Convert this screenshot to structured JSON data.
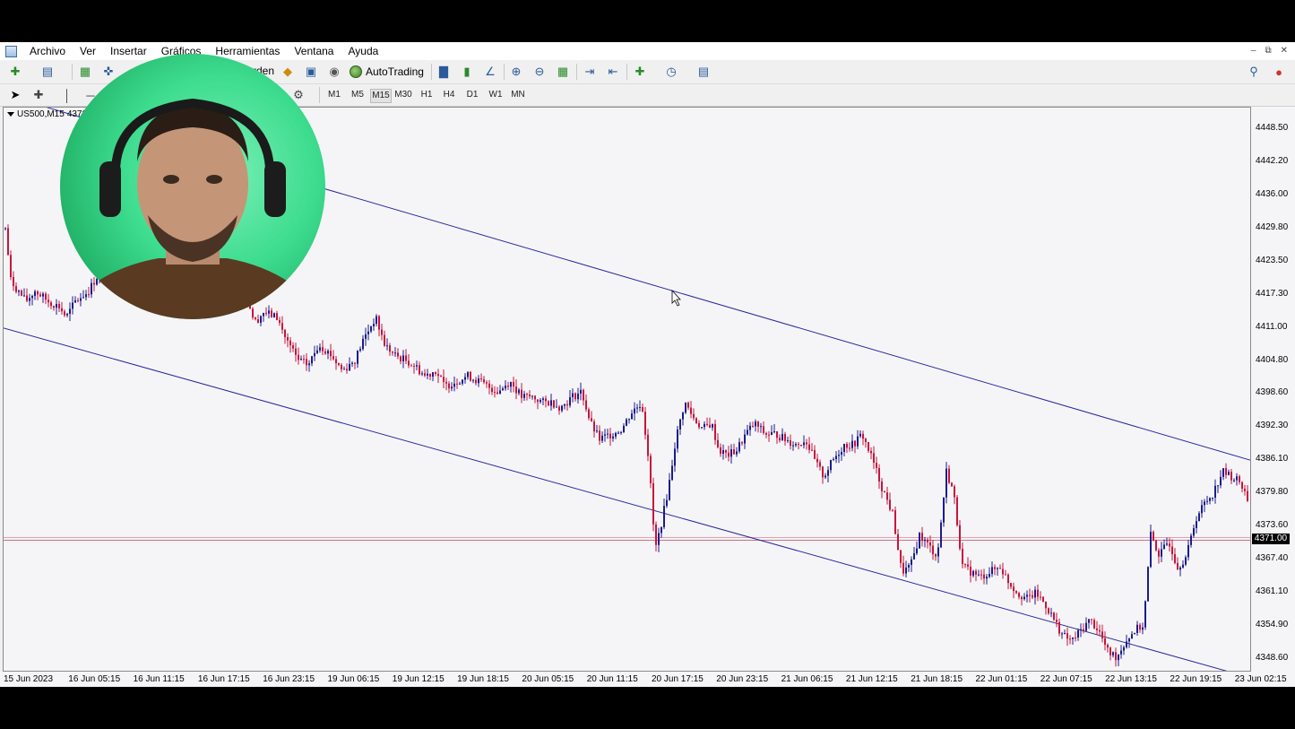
{
  "menu": [
    "Archivo",
    "Ver",
    "Insertar",
    "Gráficos",
    "Herramientas",
    "Ventana",
    "Ayuda"
  ],
  "toolbar": {
    "order_label_partial": "rden",
    "autotrading_label": "AutoTrading"
  },
  "timeframes": [
    "M1",
    "M5",
    "M15",
    "M30",
    "H1",
    "H4",
    "D1",
    "W1",
    "MN"
  ],
  "active_timeframe": "M15",
  "symbol": "US500,M15",
  "symbol_price_partial": "4372",
  "price_axis": [
    "4448.50",
    "4442.20",
    "4436.00",
    "4429.80",
    "4423.50",
    "4417.30",
    "4411.00",
    "4404.80",
    "4398.60",
    "4392.30",
    "4386.10",
    "4379.80",
    "4373.60",
    "4367.40",
    "4361.10",
    "4354.90",
    "4348.60"
  ],
  "current_price": "4371.00",
  "time_axis": [
    "15 Jun 2023",
    "16 Jun 05:15",
    "16 Jun 11:15",
    "16 Jun 17:15",
    "16 Jun 23:15",
    "19 Jun 06:15",
    "19 Jun 12:15",
    "19 Jun 18:15",
    "20 Jun 05:15",
    "20 Jun 11:15",
    "20 Jun 17:15",
    "20 Jun 23:15",
    "21 Jun 06:15",
    "21 Jun 12:15",
    "21 Jun 18:15",
    "22 Jun 01:15",
    "22 Jun 07:15",
    "22 Jun 13:15",
    "22 Jun 19:15",
    "23 Jun 02:15"
  ],
  "colors": {
    "bull_candle": "#1c1c8c",
    "bear_candle": "#c8143c",
    "channel_line": "#2a2aa0",
    "price_line": "#d07080",
    "background": "#f5f5f7"
  },
  "chart_data": {
    "type": "candlestick",
    "symbol": "US500",
    "timeframe": "M15",
    "ylim": [
      4345,
      4455
    ],
    "close_path": [
      [
        0,
        4433
      ],
      [
        8,
        4420
      ],
      [
        16,
        4418
      ],
      [
        25,
        4416
      ],
      [
        35,
        4418
      ],
      [
        50,
        4416
      ],
      [
        62,
        4415
      ],
      [
        70,
        4413
      ],
      [
        80,
        4416
      ],
      [
        95,
        4418
      ],
      [
        105,
        4421
      ],
      [
        118,
        4423
      ],
      [
        270,
        4418
      ],
      [
        280,
        4412
      ],
      [
        290,
        4414
      ],
      [
        305,
        4413
      ],
      [
        315,
        4409
      ],
      [
        328,
        4405
      ],
      [
        340,
        4404
      ],
      [
        352,
        4408
      ],
      [
        365,
        4406
      ],
      [
        378,
        4403
      ],
      [
        392,
        4405
      ],
      [
        402,
        4409
      ],
      [
        415,
        4413
      ],
      [
        425,
        4408
      ],
      [
        435,
        4406
      ],
      [
        448,
        4405
      ],
      [
        458,
        4404
      ],
      [
        470,
        4402
      ],
      [
        482,
        4403
      ],
      [
        492,
        4400
      ],
      [
        505,
        4401
      ],
      [
        518,
        4402
      ],
      [
        530,
        4401
      ],
      [
        540,
        4400
      ],
      [
        552,
        4399
      ],
      [
        565,
        4401
      ],
      [
        578,
        4398
      ],
      [
        590,
        4398
      ],
      [
        602,
        4397
      ],
      [
        612,
        4397
      ],
      [
        622,
        4396
      ],
      [
        634,
        4398
      ],
      [
        645,
        4399
      ],
      [
        655,
        4393
      ],
      [
        665,
        4390
      ],
      [
        678,
        4391
      ],
      [
        690,
        4392
      ],
      [
        700,
        4395
      ],
      [
        712,
        4397
      ],
      [
        720,
        4386
      ],
      [
        727,
        4369
      ],
      [
        735,
        4375
      ],
      [
        742,
        4381
      ],
      [
        750,
        4390
      ],
      [
        760,
        4397
      ],
      [
        770,
        4394
      ],
      [
        780,
        4392
      ],
      [
        790,
        4393
      ],
      [
        798,
        4388
      ],
      [
        808,
        4387
      ],
      [
        818,
        4388
      ],
      [
        828,
        4391
      ],
      [
        838,
        4393
      ],
      [
        850,
        4391
      ],
      [
        862,
        4391
      ],
      [
        872,
        4390
      ],
      [
        885,
        4389
      ],
      [
        895,
        4390
      ],
      [
        905,
        4386
      ],
      [
        915,
        4383
      ],
      [
        925,
        4386
      ],
      [
        938,
        4389
      ],
      [
        948,
        4389
      ],
      [
        958,
        4391
      ],
      [
        970,
        4386
      ],
      [
        980,
        4381
      ],
      [
        992,
        4376
      ],
      [
        1002,
        4365
      ],
      [
        1012,
        4366
      ],
      [
        1022,
        4372
      ],
      [
        1032,
        4370
      ],
      [
        1042,
        4368
      ],
      [
        1052,
        4384
      ],
      [
        1060,
        4380
      ],
      [
        1070,
        4366
      ],
      [
        1080,
        4365
      ],
      [
        1090,
        4364
      ],
      [
        1100,
        4365
      ],
      [
        1112,
        4366
      ],
      [
        1122,
        4363
      ],
      [
        1132,
        4361
      ],
      [
        1142,
        4360
      ],
      [
        1152,
        4361
      ],
      [
        1162,
        4359
      ],
      [
        1172,
        4356
      ],
      [
        1182,
        4353
      ],
      [
        1192,
        4352
      ],
      [
        1202,
        4354
      ],
      [
        1212,
        4356
      ],
      [
        1222,
        4354
      ],
      [
        1232,
        4350
      ],
      [
        1242,
        4349
      ],
      [
        1252,
        4352
      ],
      [
        1262,
        4354
      ],
      [
        1272,
        4355
      ],
      [
        1280,
        4372
      ],
      [
        1290,
        4368
      ],
      [
        1300,
        4371
      ],
      [
        1310,
        4366
      ],
      [
        1320,
        4368
      ],
      [
        1330,
        4375
      ],
      [
        1340,
        4378
      ],
      [
        1350,
        4380
      ],
      [
        1360,
        4384
      ],
      [
        1370,
        4383
      ],
      [
        1380,
        4382
      ],
      [
        1390,
        4378
      ]
    ],
    "channel_upper": [
      [
        0,
        4455
      ],
      [
        1393,
        4386
      ]
    ],
    "channel_lower": [
      [
        0,
        4411
      ],
      [
        1393,
        4345
      ]
    ],
    "current_price": 4371.0
  }
}
